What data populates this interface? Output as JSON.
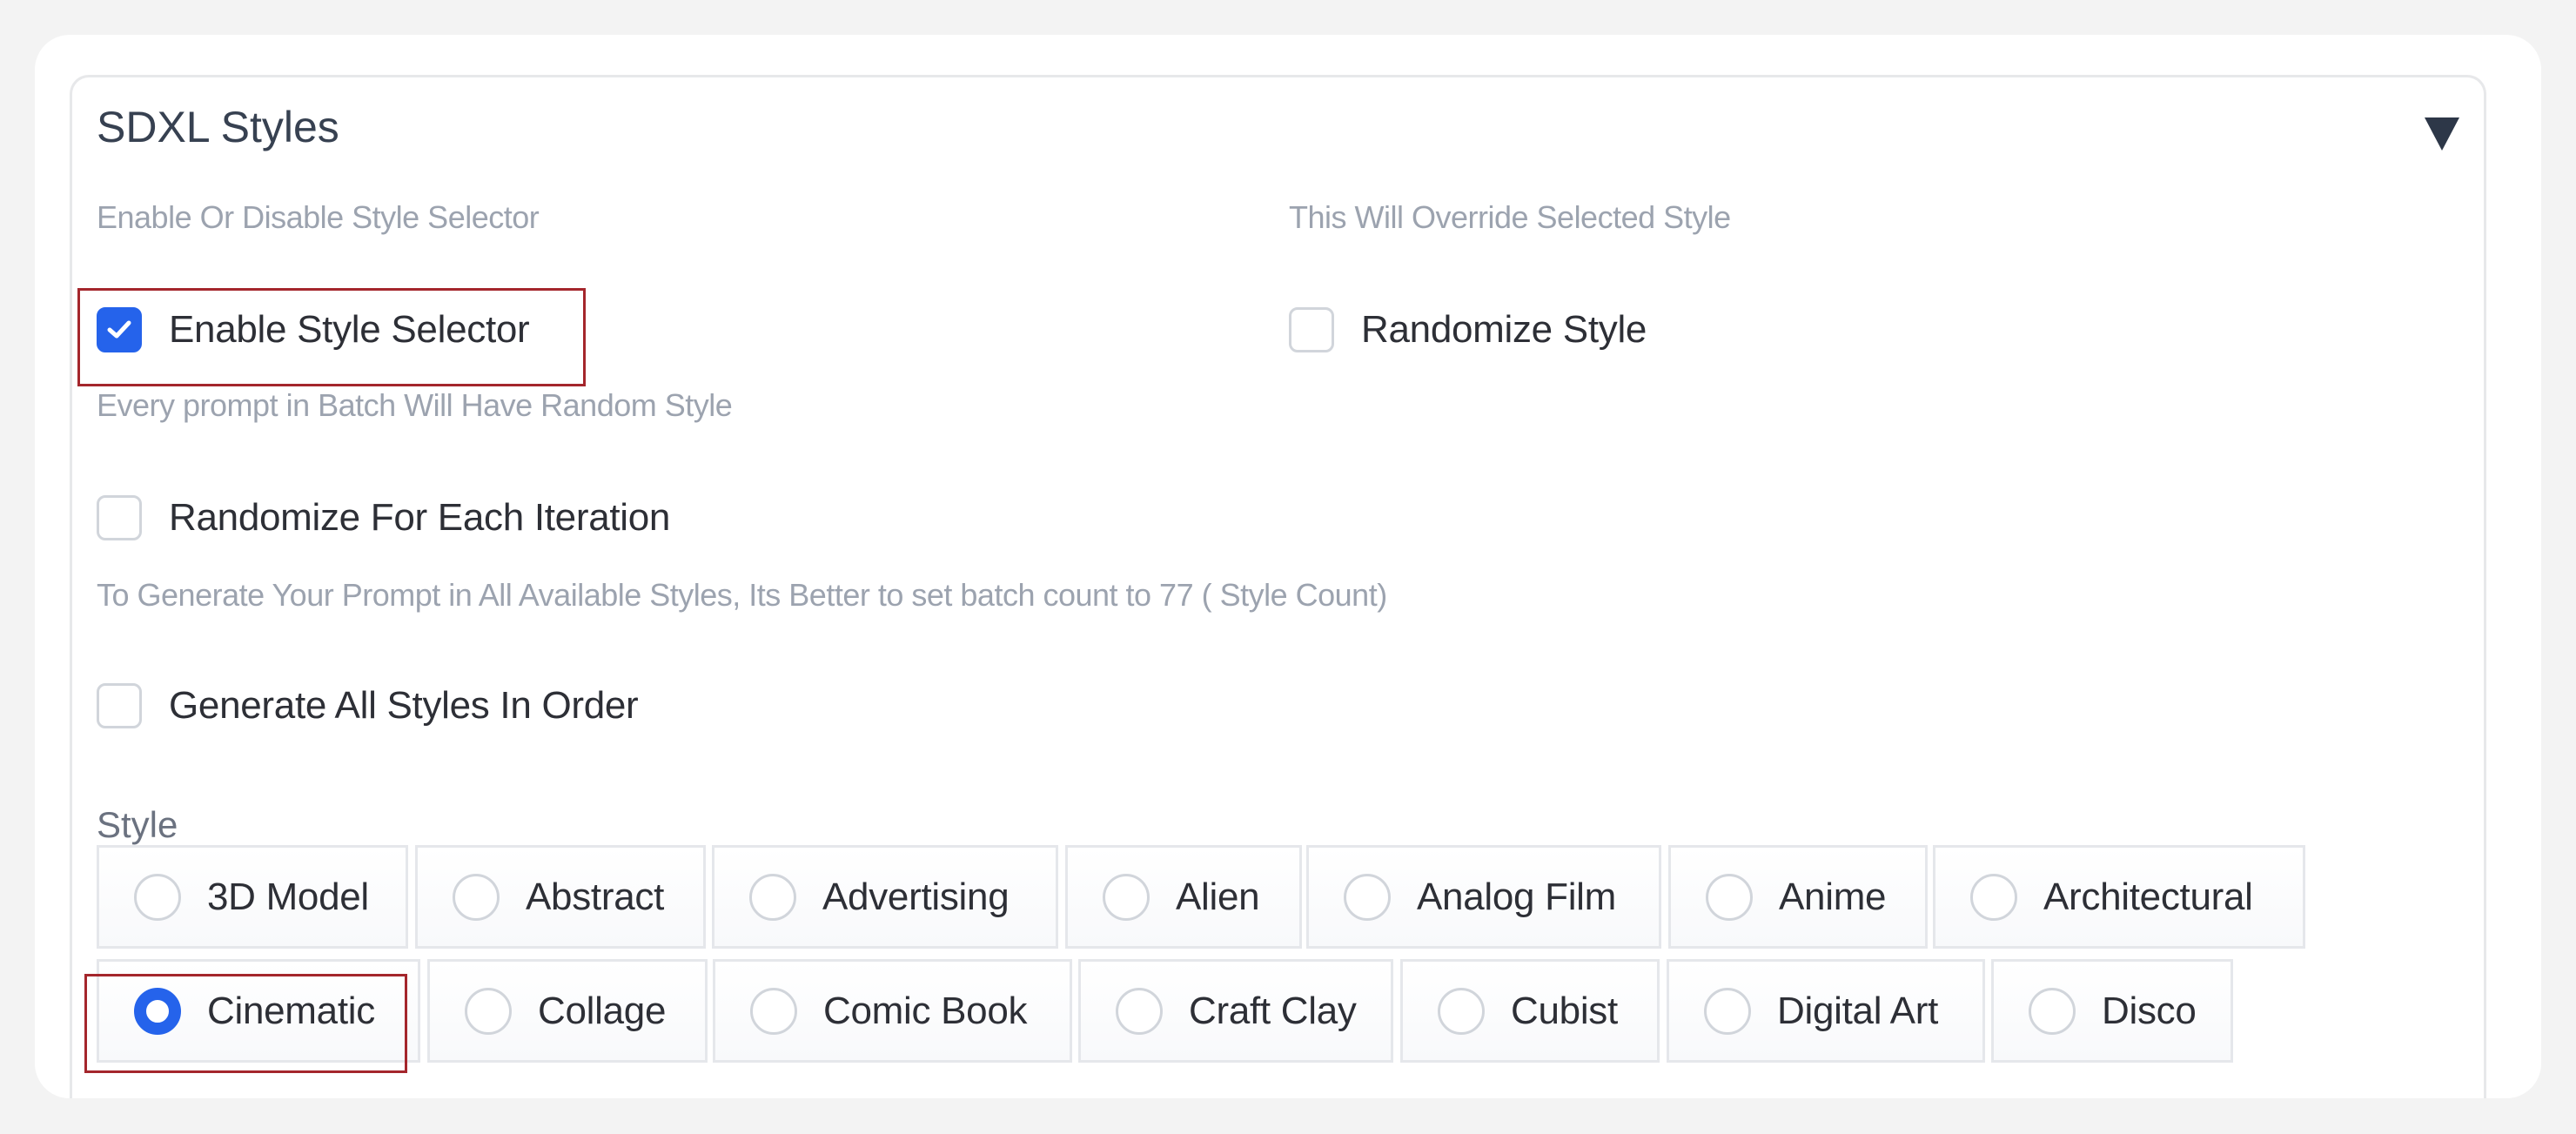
{
  "panel": {
    "title": "SDXL Styles",
    "collapse_icon": "triangle-down-icon"
  },
  "options": {
    "enable_selector": {
      "hint": "Enable Or Disable Style Selector",
      "label": "Enable Style Selector",
      "checked": true
    },
    "randomize_style": {
      "hint": "This Will Override Selected Style",
      "label": "Randomize Style",
      "checked": false
    },
    "randomize_each": {
      "hint": "Every prompt in Batch Will Have Random Style",
      "label": "Randomize For Each Iteration",
      "checked": false
    },
    "generate_all": {
      "hint": "To Generate Your Prompt in All Available Styles, Its Better to set batch count to 77 ( Style Count)",
      "label": "Generate All Styles In Order",
      "checked": false
    }
  },
  "style": {
    "label": "Style",
    "selected": "Cinematic",
    "choices": [
      "3D Model",
      "Abstract",
      "Advertising",
      "Alien",
      "Analog Film",
      "Anime",
      "Architectural",
      "Cinematic",
      "Collage",
      "Comic Book",
      "Craft Clay",
      "Cubist",
      "Digital Art",
      "Disco"
    ]
  },
  "colors": {
    "accent": "#2563eb",
    "highlight": "#a4262c"
  }
}
